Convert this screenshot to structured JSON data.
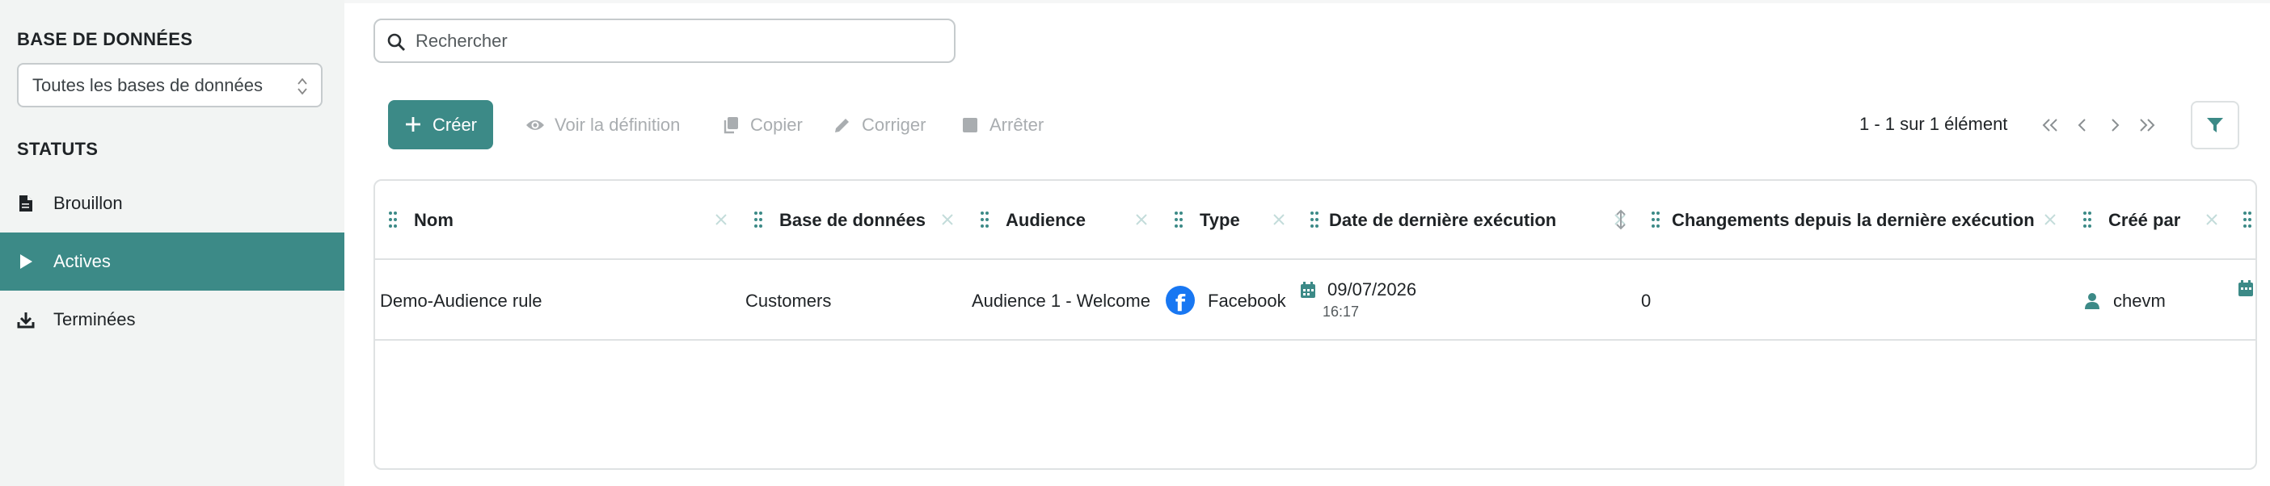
{
  "sidebar": {
    "database_heading": "BASE DE DONNÉES",
    "database_select_value": "Toutes les bases de données",
    "status_heading": "STATUTS",
    "items": [
      {
        "label": "Brouillon",
        "icon": "file-icon",
        "active": false
      },
      {
        "label": "Actives",
        "icon": "play-icon",
        "active": true
      },
      {
        "label": "Terminées",
        "icon": "download-icon",
        "active": false
      }
    ]
  },
  "search": {
    "placeholder": "Rechercher"
  },
  "toolbar": {
    "create_label": "Créer",
    "view_definition_label": "Voir la définition",
    "copy_label": "Copier",
    "fix_label": "Corriger",
    "stop_label": "Arrêter"
  },
  "pagination": {
    "summary": "1 - 1 sur 1 élément"
  },
  "table": {
    "columns": [
      "Nom",
      "Base de données",
      "Audience",
      "Type",
      "Date de dernière exécution",
      "Changements depuis la dernière exécution",
      "Créé par"
    ],
    "rows": [
      {
        "name": "Demo-Audience rule",
        "database": "Customers",
        "audience": "Audience 1 - Welcome",
        "type": "Facebook",
        "last_run_date": "09/07/2026",
        "last_run_time": "16:17",
        "changes": "0",
        "created_by": "chevm"
      }
    ]
  },
  "colors": {
    "accent": "#3c8a87",
    "sidebar_bg": "#f2f4f3",
    "facebook": "#1877f2",
    "disabled": "#a9adb0"
  }
}
